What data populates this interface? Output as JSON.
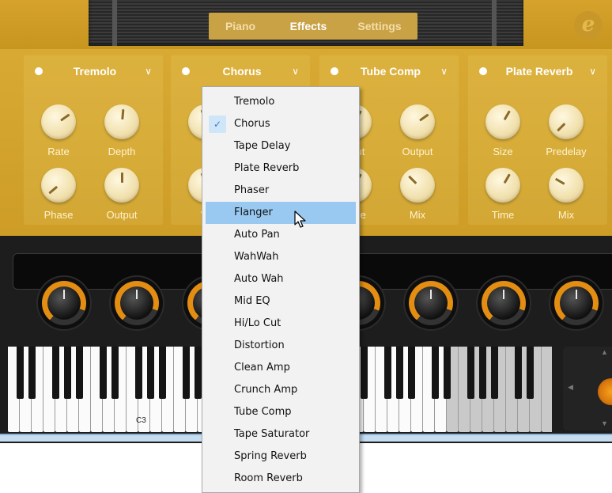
{
  "tabs": [
    "Piano",
    "Effects",
    "Settings"
  ],
  "active_tab": "Effects",
  "logo": "e",
  "slots": [
    {
      "name": "Tremolo",
      "knobs": [
        "Rate",
        "Depth",
        "Phase",
        "Output"
      ]
    },
    {
      "name": "Chorus",
      "knobs": [
        "R",
        "",
        "W",
        ""
      ]
    },
    {
      "name": "Tube Comp",
      "knobs": [
        "ut",
        "Output",
        "ve",
        "Mix"
      ]
    },
    {
      "name": "Plate Reverb",
      "knobs": [
        "Size",
        "Predelay",
        "Time",
        "Mix"
      ]
    }
  ],
  "menu": {
    "items": [
      "Tremolo",
      "Chorus",
      "Tape Delay",
      "Plate Reverb",
      "Phaser",
      "Flanger",
      "Auto Pan",
      "WahWah",
      "Auto Wah",
      "Mid EQ",
      "Hi/Lo Cut",
      "Distortion",
      "Clean Amp",
      "Crunch Amp",
      "Tube Comp",
      "Tape Saturator",
      "Spring Reverb",
      "Room Reverb"
    ],
    "checked": "Chorus",
    "highlighted": "Flanger"
  },
  "keyboard": {
    "octave_label": "C3"
  },
  "icons": {
    "check": "check-icon",
    "chevron": "chevron-down-icon",
    "cursor": "pointer-cursor-icon"
  },
  "colors": {
    "gold": "#d9aa33",
    "highlight": "#99c9f1",
    "orange": "#e38d13"
  }
}
